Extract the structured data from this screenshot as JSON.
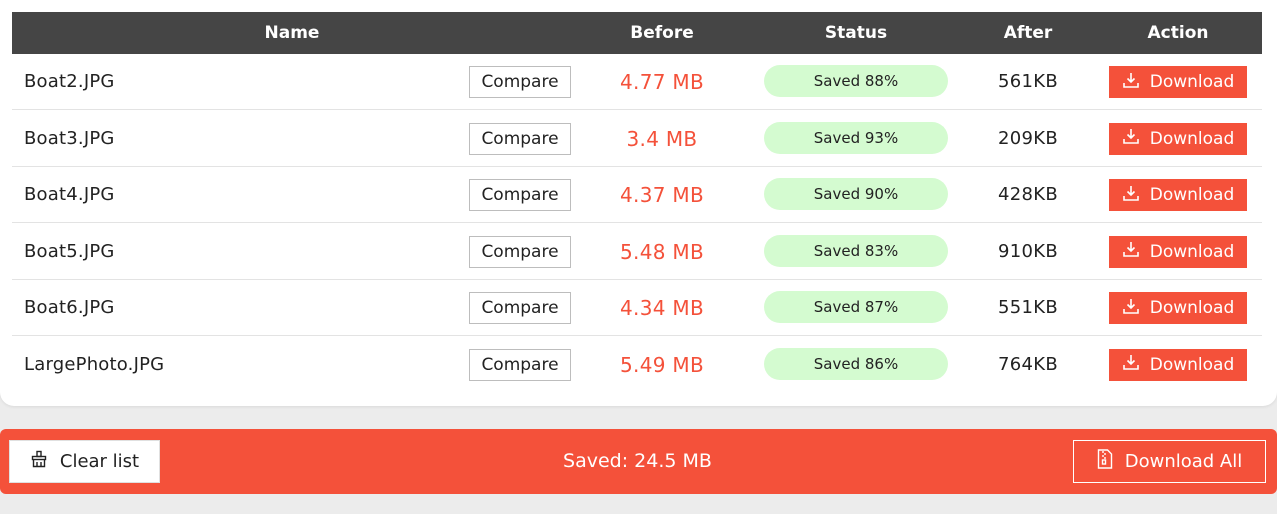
{
  "header": {
    "name": "Name",
    "before": "Before",
    "status": "Status",
    "after": "After",
    "action": "Action"
  },
  "rows": [
    {
      "name": "Boat2.JPG",
      "compare": "Compare",
      "before": "4.77 MB",
      "status": "Saved 88%",
      "after": "561KB",
      "download": "Download"
    },
    {
      "name": "Boat3.JPG",
      "compare": "Compare",
      "before": "3.4 MB",
      "status": "Saved 93%",
      "after": "209KB",
      "download": "Download"
    },
    {
      "name": "Boat4.JPG",
      "compare": "Compare",
      "before": "4.37 MB",
      "status": "Saved 90%",
      "after": "428KB",
      "download": "Download"
    },
    {
      "name": "Boat5.JPG",
      "compare": "Compare",
      "before": "5.48 MB",
      "status": "Saved 83%",
      "after": "910KB",
      "download": "Download"
    },
    {
      "name": "Boat6.JPG",
      "compare": "Compare",
      "before": "4.34 MB",
      "status": "Saved 87%",
      "after": "551KB",
      "download": "Download"
    },
    {
      "name": "LargePhoto.JPG",
      "compare": "Compare",
      "before": "5.49 MB",
      "status": "Saved 86%",
      "after": "764KB",
      "download": "Download"
    }
  ],
  "footer": {
    "clear_label": "Clear list",
    "saved_text": "Saved: 24.5 MB",
    "download_all_label": "Download All"
  },
  "icons": {
    "download": "download-icon",
    "clear": "broom-icon",
    "download_all": "file-archive-icon"
  },
  "colors": {
    "accent": "#f4513a",
    "header_bg": "#454545",
    "status_bg": "#d4fbd0"
  }
}
